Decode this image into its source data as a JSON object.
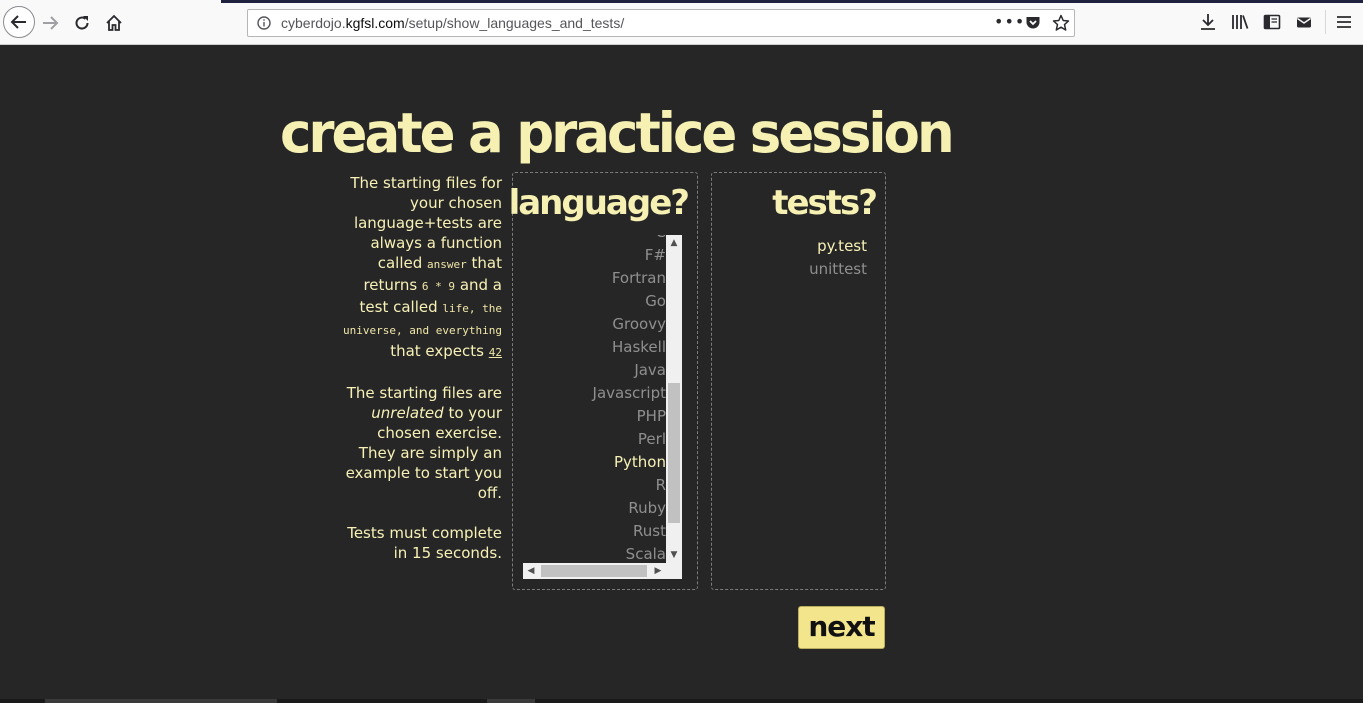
{
  "browser": {
    "url_prefix": "cyberdojo.",
    "url_host": "kgfsl.com",
    "url_path": "/setup/show_languages_and_tests/",
    "more_label": "•••"
  },
  "page": {
    "title": "create a practice session",
    "info": {
      "p1": {
        "t1": "The starting files for your chosen language+tests are always a function called ",
        "c1": "answer",
        "t2": " that returns ",
        "c2": "6 * 9",
        "t3": " and a test called ",
        "c3": "life, the universe, and everything",
        "t4": " that expects ",
        "c4": "42"
      },
      "p2": {
        "t1": "The starting files are ",
        "em": "unrelated",
        "t2": " to your chosen exercise. They are simply an example to start you off."
      },
      "p3": "Tests must complete in 15 seconds."
    },
    "language_heading": "language?",
    "tests_heading": "tests?",
    "languages": [
      "C",
      "F#",
      "Fortran",
      "Go",
      "Groovy",
      "Haskell",
      "Java",
      "Javascript",
      "PHP",
      "Perl",
      "Python",
      "R",
      "Ruby",
      "Rust",
      "Scala"
    ],
    "selected_language": "Python",
    "tests": [
      "py.test",
      "unittest"
    ],
    "selected_test": "py.test",
    "next_label": "next"
  },
  "colors": {
    "background": "#262626",
    "accent": "#f6f1b2",
    "unselected": "#8f8f8f",
    "button": "#f2e58c"
  }
}
